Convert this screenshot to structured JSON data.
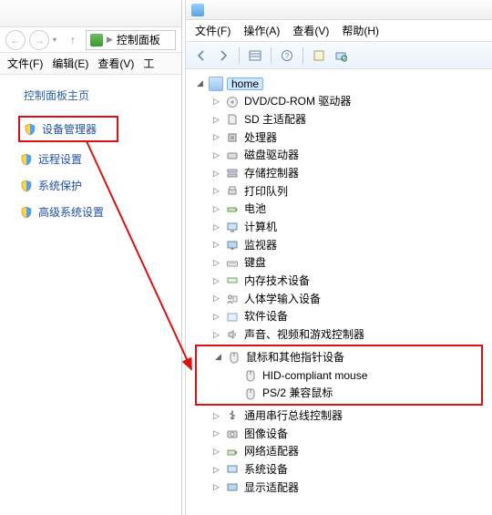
{
  "left": {
    "addr_text": "控制面板",
    "menu": {
      "file": "文件(F)",
      "edit": "编辑(E)",
      "view": "查看(V)",
      "tools": "工"
    },
    "side_title": "控制面板主页",
    "links": {
      "device_manager": "设备管理器",
      "remote": "远程设置",
      "protection": "系统保护",
      "advanced": "高级系统设置"
    }
  },
  "right": {
    "menu": {
      "file": "文件(F)",
      "action": "操作(A)",
      "view": "查看(V)",
      "help": "帮助(H)"
    },
    "root": "home",
    "cats": {
      "dvd": "DVD/CD-ROM 驱动器",
      "sd": "SD 主适配器",
      "cpu": "处理器",
      "disk": "磁盘驱动器",
      "storage": "存储控制器",
      "printq": "打印队列",
      "battery": "电池",
      "computer": "计算机",
      "monitor": "监视器",
      "keyboard": "键盘",
      "memtech": "内存技术设备",
      "hid": "人体学输入设备",
      "softdev": "软件设备",
      "sound": "声音、视频和游戏控制器",
      "mouse": "鼠标和其他指针设备",
      "mouse_hid": "HID-compliant mouse",
      "mouse_ps2": "PS/2 兼容鼠标",
      "usb": "通用串行总线控制器",
      "imaging": "图像设备",
      "net": "网络适配器",
      "system": "系统设备",
      "display": "显示适配器"
    }
  }
}
